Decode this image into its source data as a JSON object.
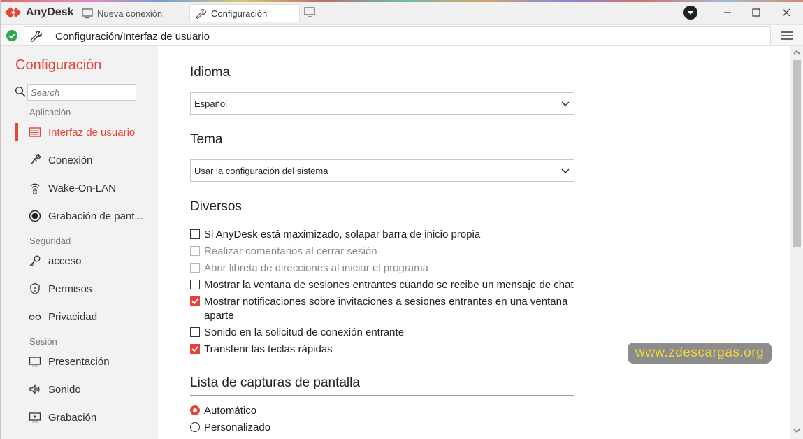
{
  "app": {
    "name": "AnyDesk",
    "accent": "#e0463c"
  },
  "tabs": [
    {
      "label": "Nueva conexión",
      "icon": "monitor-icon"
    },
    {
      "label": "Configuración",
      "icon": "wrench-icon"
    }
  ],
  "address": {
    "path": "Configuración/Interfaz de usuario",
    "status": "connected"
  },
  "sidebar": {
    "title": "Configuración",
    "search_placeholder": "Search",
    "sections": [
      {
        "label": "Aplicación",
        "items": [
          {
            "label": "Interfaz de usuario",
            "icon": "ui-icon",
            "active": true
          },
          {
            "label": "Conexión",
            "icon": "connection-icon"
          },
          {
            "label": "Wake-On-LAN",
            "icon": "wifi-icon"
          },
          {
            "label": "Grabación de pant...",
            "icon": "record-icon"
          }
        ]
      },
      {
        "label": "Seguridad",
        "items": [
          {
            "label": "acceso",
            "icon": "key-icon"
          },
          {
            "label": "Permisos",
            "icon": "shield-icon"
          },
          {
            "label": "Privacidad",
            "icon": "glasses-icon"
          }
        ]
      },
      {
        "label": "Sesión",
        "items": [
          {
            "label": "Presentación",
            "icon": "display-icon"
          },
          {
            "label": "Sonido",
            "icon": "speaker-icon"
          },
          {
            "label": "Grabación",
            "icon": "screen-record-icon"
          }
        ]
      }
    ]
  },
  "main": {
    "idioma": {
      "heading": "Idioma",
      "value": "Español"
    },
    "tema": {
      "heading": "Tema",
      "value": "Usar la configuración del sistema"
    },
    "diversos": {
      "heading": "Diversos",
      "options": [
        {
          "label": "Si AnyDesk está maximizado, solapar barra de inicio propia",
          "checked": false,
          "disabled": false
        },
        {
          "label": "Realizar comentarios al cerrar sesión",
          "checked": false,
          "disabled": true
        },
        {
          "label": "Abrir libreta de direcciones al iniciar el programa",
          "checked": false,
          "disabled": true
        },
        {
          "label": "Mostrar la ventana de sesiones entrantes cuando se recibe un mensaje de chat",
          "checked": false,
          "disabled": false
        },
        {
          "label": "Mostrar notificaciones sobre invitaciones a sesiones entrantes en una ventana aparte",
          "checked": true,
          "disabled": false
        },
        {
          "label": "Sonido en la solicitud de conexión entrante",
          "checked": false,
          "disabled": false
        },
        {
          "label": "Transferir las teclas rápidas",
          "checked": true,
          "disabled": false
        }
      ]
    },
    "capturas": {
      "heading": "Lista de capturas de pantalla",
      "options": [
        {
          "label": "Automático",
          "selected": true
        },
        {
          "label": "Personalizado",
          "selected": false
        }
      ]
    }
  },
  "watermark": "www.zdescargas.org"
}
